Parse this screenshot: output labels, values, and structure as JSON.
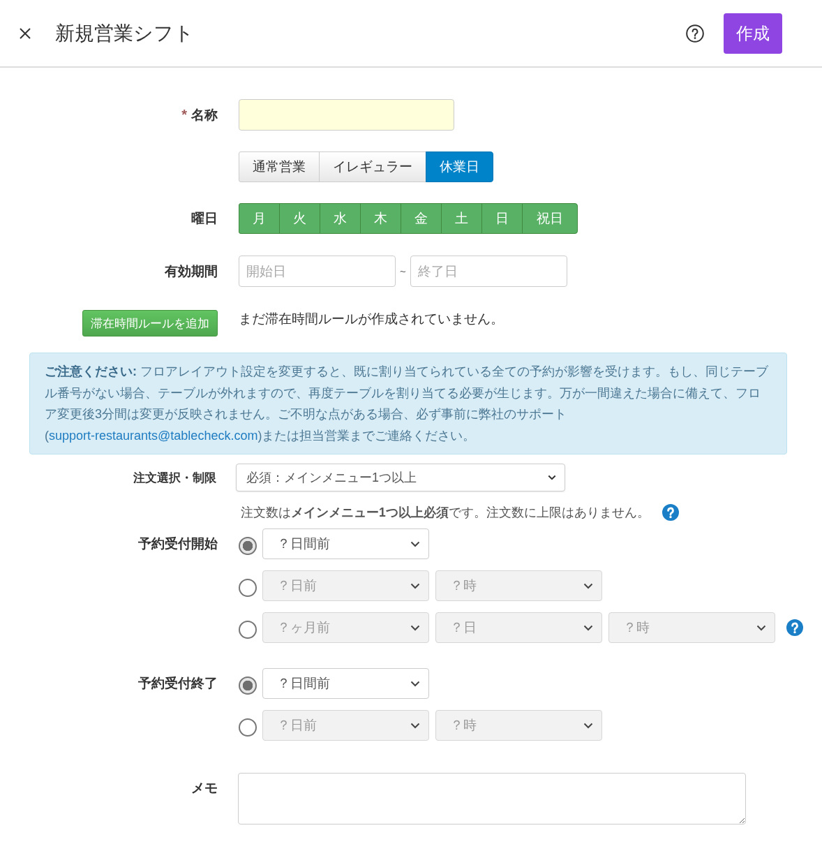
{
  "header": {
    "title": "新規営業シフト",
    "create_button": "作成"
  },
  "name": {
    "label": "名称",
    "required_mark": "*"
  },
  "shift_types": [
    {
      "label": "通常営業",
      "selected": false
    },
    {
      "label": "イレギュラー",
      "selected": false
    },
    {
      "label": "休業日",
      "selected": true
    }
  ],
  "weekdays": {
    "label": "曜日",
    "days": [
      {
        "label": "月",
        "selected": true
      },
      {
        "label": "火",
        "selected": true
      },
      {
        "label": "水",
        "selected": true
      },
      {
        "label": "木",
        "selected": true
      },
      {
        "label": "金",
        "selected": true
      },
      {
        "label": "土",
        "selected": true
      },
      {
        "label": "日",
        "selected": true
      },
      {
        "label": "祝日",
        "selected": true
      }
    ]
  },
  "validity": {
    "label": "有効期間",
    "start_placeholder": "開始日",
    "separator": "~",
    "end_placeholder": "終了日"
  },
  "stay_rules": {
    "add_button": "滞在時間ルールを追加",
    "empty_message": "まだ滞在時間ルールが作成されていません。"
  },
  "notice": {
    "text": "**ご注意ください:** フロアレイアウト設定を変更すると、既に割り当てられている全ての予約が影響を受けます。もし、同じテーブル番号がない場合、テーブルが外れますので、再度テーブルを割り当てる必要が生じます。万が一間違えた場合に備えて、フロア変更後3分間は変更が反映されません。ご不明な点がある場合、必ず事前に弊社のサポート(",
    "link": "support-restaurants@tablecheck.com",
    "text_after": ")または担当営業までご連絡ください。"
  },
  "order_limit": {
    "label": "注文選択・制限",
    "value": "必須：メインメニュー1つ以上",
    "hint": "注文数は**メインメニュー1つ以上必須**です。注文数に上限はありません。",
    "help": true
  },
  "booking_start": {
    "label": "予約受付開始",
    "options": [
      {
        "selected": true,
        "help": false,
        "selects": [
          {
            "value": "？日間前",
            "disabled": false
          }
        ]
      },
      {
        "selected": false,
        "help": false,
        "selects": [
          {
            "value": "？日前",
            "disabled": true
          },
          {
            "value": "？時",
            "disabled": true
          }
        ]
      },
      {
        "selected": false,
        "help": true,
        "selects": [
          {
            "value": "？ヶ月前",
            "disabled": true
          },
          {
            "value": "？日",
            "disabled": true
          },
          {
            "value": "？時",
            "disabled": true
          }
        ]
      }
    ]
  },
  "booking_end": {
    "label": "予約受付終了",
    "options": [
      {
        "selected": true,
        "help": false,
        "selects": [
          {
            "value": "？日間前",
            "disabled": false
          }
        ]
      },
      {
        "selected": false,
        "help": false,
        "selects": [
          {
            "value": "？日前",
            "disabled": true
          },
          {
            "value": "？時",
            "disabled": true
          }
        ]
      }
    ]
  },
  "memo": {
    "label": "メモ"
  }
}
